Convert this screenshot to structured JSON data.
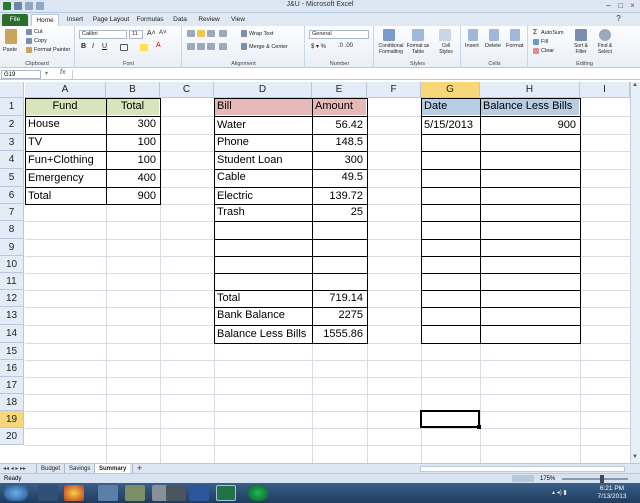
{
  "window": {
    "title": "J&U - Microsoft Excel"
  },
  "ribbon": {
    "tabs": [
      "File",
      "Home",
      "Insert",
      "Page Layout",
      "Formulas",
      "Data",
      "Review",
      "View"
    ],
    "clipboard": {
      "paste": "Paste",
      "cut": "Cut",
      "copy": "Copy",
      "format_painter": "Format Painter",
      "label": "Clipboard"
    },
    "font": {
      "name": "Calibri",
      "size": "11",
      "label": "Font"
    },
    "alignment": {
      "wrap": "Wrap Text",
      "merge": "Merge & Center",
      "label": "Alignment"
    },
    "number": {
      "format": "General",
      "label": "Number"
    },
    "styles": {
      "conditional": "Conditional Formatting",
      "format_table": "Format as Table",
      "cell_styles": "Cell Styles",
      "label": "Styles"
    },
    "cells": {
      "insert": "Insert",
      "delete": "Delete",
      "format": "Format",
      "label": "Cells"
    },
    "editing": {
      "autosum": "AutoSum",
      "fill": "Fill",
      "clear": "Clear",
      "sort": "Sort & Filter",
      "find": "Find & Select",
      "label": "Editing"
    }
  },
  "formula_bar": {
    "name_box": "G19",
    "fx": "fx",
    "value": ""
  },
  "columns": [
    "A",
    "B",
    "C",
    "D",
    "E",
    "F",
    "G",
    "H",
    "I"
  ],
  "rows": [
    "1",
    "2",
    "3",
    "4",
    "5",
    "6",
    "7",
    "8",
    "9",
    "10",
    "11",
    "12",
    "13",
    "14",
    "15",
    "16",
    "17",
    "18",
    "19",
    "20"
  ],
  "fund_table": {
    "header_fund": "Fund",
    "header_total": "Total",
    "rows": [
      {
        "fund": "House",
        "total": "300"
      },
      {
        "fund": "TV",
        "total": "100"
      },
      {
        "fund": "Fun+Clothing",
        "total": "100"
      },
      {
        "fund": "Emergency",
        "total": "400"
      },
      {
        "fund": "Total",
        "total": "900"
      }
    ]
  },
  "bill_table": {
    "header_bill": "Bill",
    "header_amount": "Amount",
    "rows": [
      {
        "bill": "Water",
        "amount": "56.42"
      },
      {
        "bill": "Phone",
        "amount": "148.5"
      },
      {
        "bill": "Student Loan",
        "amount": "300"
      },
      {
        "bill": "Cable",
        "amount": "49.5"
      },
      {
        "bill": "Electric",
        "amount": "139.72"
      },
      {
        "bill": "Trash",
        "amount": "25"
      }
    ],
    "total_label": "Total",
    "total_value": "719.14",
    "bank_label": "Bank Balance",
    "bank_value": "2275",
    "less_label": "Balance Less Bills",
    "less_value": "1555.86"
  },
  "date_table": {
    "header_date": "Date",
    "header_balance": "Balance Less Bills",
    "date": "5/15/2013",
    "balance": "900"
  },
  "sheets": [
    "Budget",
    "Savings",
    "Summary"
  ],
  "status": {
    "ready": "Ready",
    "zoom": "175%"
  },
  "clock": {
    "time": "6:21 PM",
    "date": "7/13/2013"
  },
  "colors": {
    "fund_header": "#d8e4bc",
    "bill_header": "#e6b8b7",
    "date_header": "#b8cce4",
    "selection": "#f8d77a"
  }
}
